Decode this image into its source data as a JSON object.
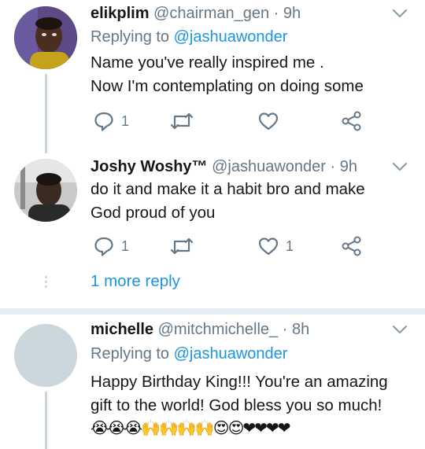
{
  "tweets": [
    {
      "name": "elikplim",
      "handle": "@chairman_gen",
      "time": "9h",
      "replying_prefix": "Replying to ",
      "replying_to": "@jashuawonder",
      "body_lines": [
        "Name you've really inspired me .",
        "Now I'm contemplating on doing some"
      ],
      "reply_count": "1",
      "like_count": ""
    },
    {
      "name": "Joshy Woshy™",
      "handle": "@jashuawonder",
      "time": "9h",
      "body_lines": [
        "do it and make it a habit bro and make",
        "God proud of you"
      ],
      "reply_count": "1",
      "like_count": "1"
    },
    {
      "name": "michelle",
      "handle": "@mitchmichelle_",
      "time": "8h",
      "replying_prefix": "Replying to ",
      "replying_to": "@jashuawonder",
      "body_lines": [
        "Happy Birthday King!!! You're an amazing",
        "gift to the world! God bless you so much!"
      ],
      "emojis": "😭😭😭🙌🙌🙌🙌😍😍❤❤❤❤"
    }
  ],
  "more_reply_label": "1 more reply",
  "separator": " · ",
  "colors": {
    "link": "#1b95e0",
    "secondary_text": "#657786",
    "thread_line": "#ccd6dd",
    "divider": "#e6ecf0",
    "heart_red": "#e0245e"
  },
  "icons": [
    "chevron-down-icon",
    "reply-icon",
    "retweet-icon",
    "like-icon",
    "share-icon"
  ]
}
